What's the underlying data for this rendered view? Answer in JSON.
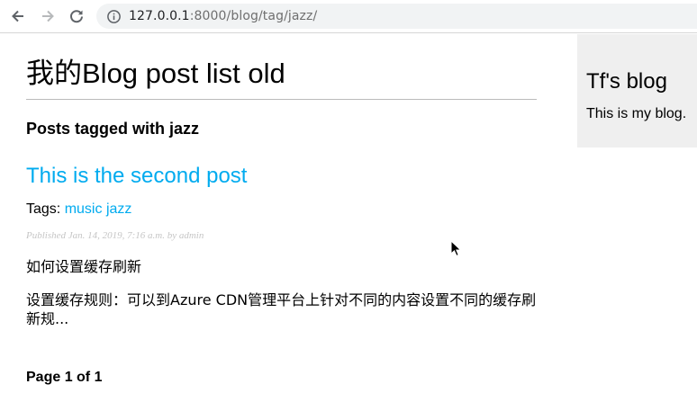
{
  "browser": {
    "url_host": "127.0.0.1",
    "url_rest": ":8000/blog/tag/jazz/"
  },
  "main": {
    "title": "我的Blog post list old",
    "tag_heading": "Posts tagged with jazz",
    "post": {
      "title": "This is the second post",
      "tags_label": "Tags:",
      "tags": [
        "music",
        "jazz"
      ],
      "published": "Published Jan. 14, 2019, 7:16 a.m. by admin",
      "paragraph1": "如何设置缓存刷新",
      "paragraph2": "设置缓存规则：可以到Azure CDN管理平台上针对不同的内容设置不同的缓存刷新规..."
    },
    "pagination": "Page 1 of 1"
  },
  "sidebar": {
    "title": "Tf's blog",
    "description": "This is my blog."
  },
  "colors": {
    "link": "#00abef",
    "sidebar_bg": "#efefef",
    "published_text": "#c6c6c6"
  }
}
